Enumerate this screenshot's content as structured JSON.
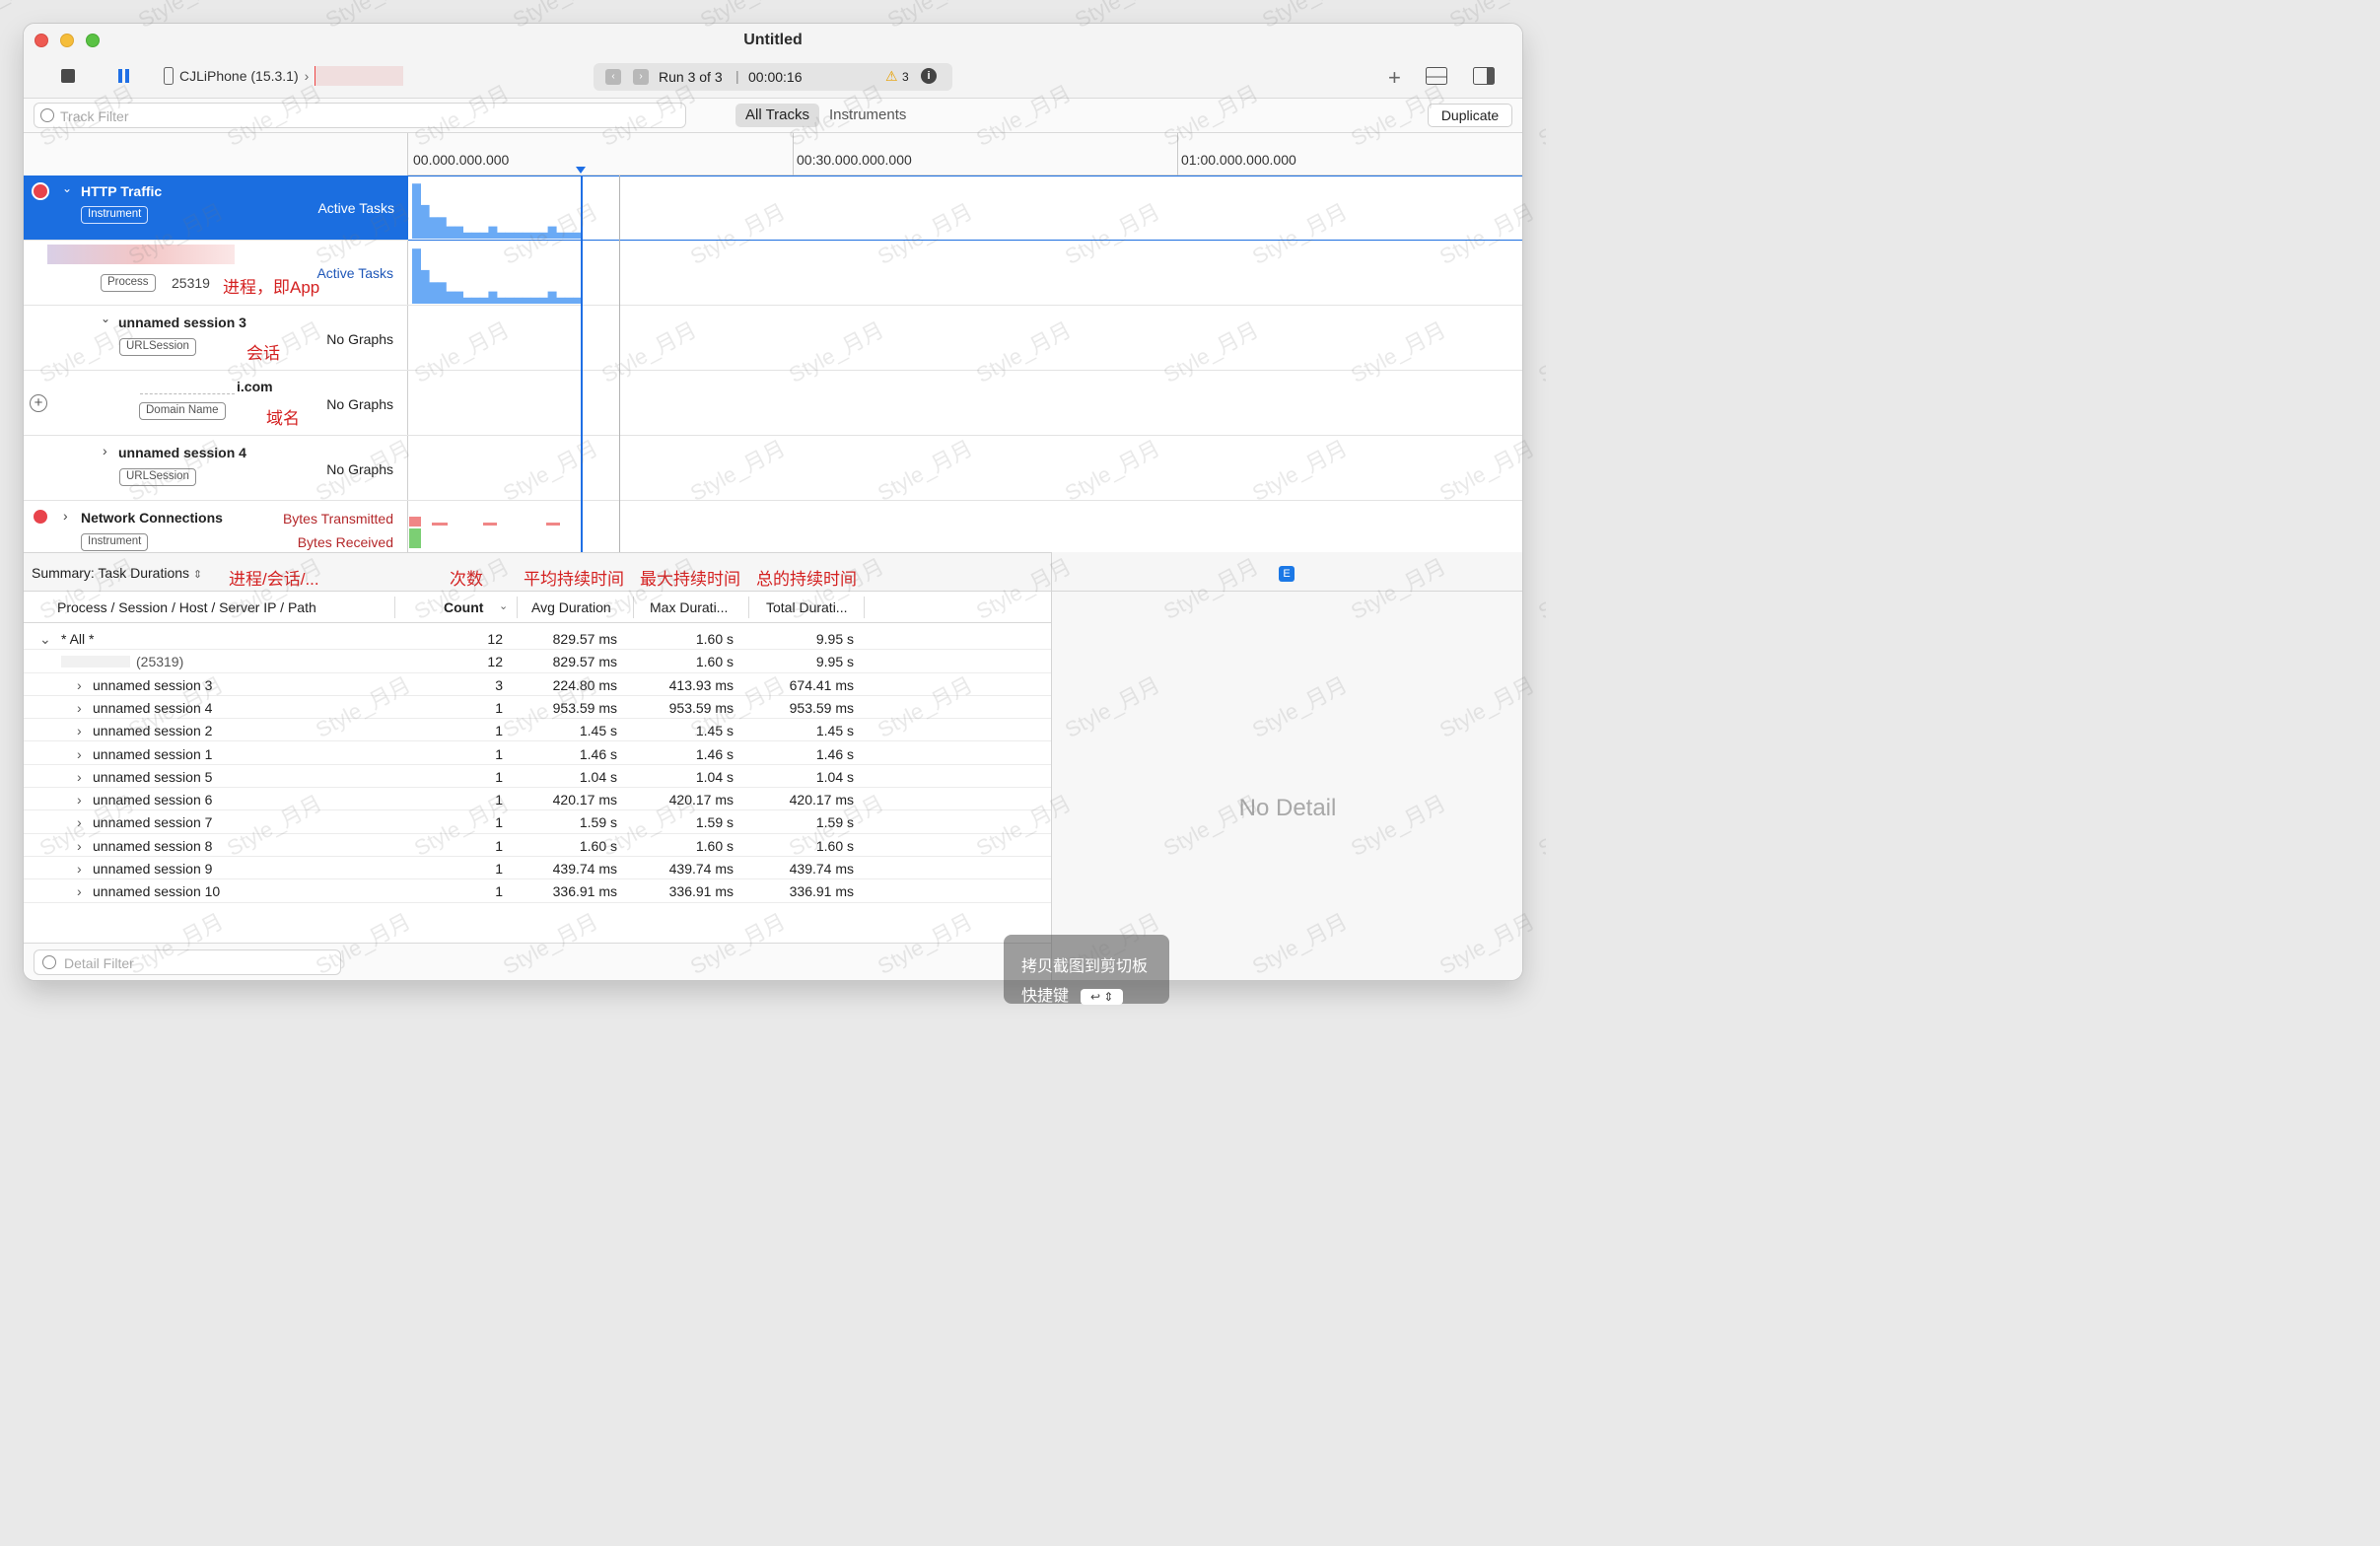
{
  "window": {
    "title": "Untitled"
  },
  "toolbar": {
    "device": "CJLiPhone (15.3.1)",
    "run": "Run 3 of 3",
    "elapsed": "00:00:16",
    "warning_count": "3"
  },
  "filter": {
    "track_placeholder": "Track Filter",
    "tabs": [
      {
        "label": "All Tracks",
        "selected": true
      },
      {
        "label": "Instruments",
        "selected": false
      }
    ],
    "duplicate_label": "Duplicate"
  },
  "ruler": {
    "ticks": [
      "00.000.000.000",
      "00:30.000.000.000",
      "01:00.000.000.000"
    ]
  },
  "tracks": [
    {
      "name": "HTTP Traffic",
      "badge": "Instrument",
      "graph_label": "Active Tasks",
      "selected": true
    },
    {
      "name": "",
      "badge": "Process",
      "pid": "25319",
      "graph_label": "Active Tasks",
      "note": "进程，即App"
    },
    {
      "name": "unnamed session 3",
      "badge": "URLSession",
      "graph_label": "No Graphs",
      "note": "会话"
    },
    {
      "name": "i.com",
      "badge": "Domain Name",
      "graph_label": "No Graphs",
      "note": "域名"
    },
    {
      "name": "unnamed session 4",
      "badge": "URLSession",
      "graph_label": "No Graphs"
    },
    {
      "name": "Network Connections",
      "badge": "Instrument",
      "graph_label": "Bytes Transmitted",
      "graph_label2": "Bytes Received"
    }
  ],
  "activity_graph": {
    "series": [
      {
        "values": [
          0.9,
          0.55,
          0.35,
          0.35,
          0.2,
          0.2,
          0.1,
          0.1,
          0.1,
          0.2,
          0.1,
          0.1,
          0.1,
          0.1,
          0.1,
          0.1,
          0.2,
          0.1,
          0.1,
          0.1
        ]
      }
    ],
    "color": "#6aaaf5"
  },
  "summary": {
    "selector": "Summary: Task Durations",
    "annotations": [
      "进程/会话/...",
      "次数",
      "平均持续时间",
      "最大持续时间",
      "总的持续时间"
    ],
    "columns": [
      "Process / Session / Host / Server IP / Path",
      "Count",
      "Avg Duration",
      "Max Durati...",
      "Total Durati..."
    ],
    "rows": [
      {
        "name": "* All *",
        "count": "12",
        "avg": "829.57 ms",
        "max": "1.60 s",
        "total": "9.95 s"
      },
      {
        "name": "(25319)",
        "count": "12",
        "avg": "829.57 ms",
        "max": "1.60 s",
        "total": "9.95 s"
      },
      {
        "name": "unnamed session 3",
        "count": "3",
        "avg": "224.80 ms",
        "max": "413.93 ms",
        "total": "674.41 ms"
      },
      {
        "name": "unnamed session 4",
        "count": "1",
        "avg": "953.59 ms",
        "max": "953.59 ms",
        "total": "953.59 ms"
      },
      {
        "name": "unnamed session 2",
        "count": "1",
        "avg": "1.45 s",
        "max": "1.45 s",
        "total": "1.45 s"
      },
      {
        "name": "unnamed session 1",
        "count": "1",
        "avg": "1.46 s",
        "max": "1.46 s",
        "total": "1.46 s"
      },
      {
        "name": "unnamed session 5",
        "count": "1",
        "avg": "1.04 s",
        "max": "1.04 s",
        "total": "1.04 s"
      },
      {
        "name": "unnamed session 6",
        "count": "1",
        "avg": "420.17 ms",
        "max": "420.17 ms",
        "total": "420.17 ms"
      },
      {
        "name": "unnamed session 7",
        "count": "1",
        "avg": "1.59 s",
        "max": "1.59 s",
        "total": "1.59 s"
      },
      {
        "name": "unnamed session 8",
        "count": "1",
        "avg": "1.60 s",
        "max": "1.60 s",
        "total": "1.60 s"
      },
      {
        "name": "unnamed session 9",
        "count": "1",
        "avg": "439.74 ms",
        "max": "439.74 ms",
        "total": "439.74 ms"
      },
      {
        "name": "unnamed session 10",
        "count": "1",
        "avg": "336.91 ms",
        "max": "336.91 ms",
        "total": "336.91 ms"
      }
    ]
  },
  "detail": {
    "badge": "E",
    "empty_text": "No Detail",
    "filter_placeholder": "Detail Filter"
  },
  "toast": {
    "title": "拷贝截图到剪切板",
    "shortcut_label": "快捷键"
  },
  "watermark": "Style_月月"
}
